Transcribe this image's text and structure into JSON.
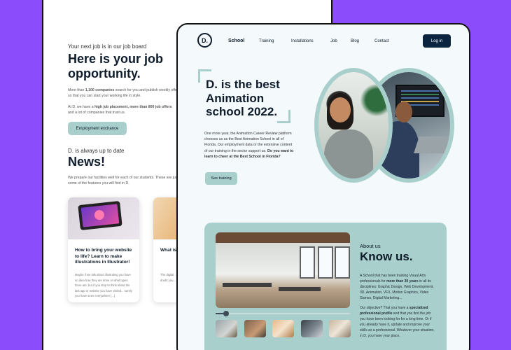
{
  "back": {
    "kicker": "Your next job is in our job board",
    "title": "Here is your job opportunity.",
    "para1_pre": "More than ",
    "para1_bold": "1,100 companies",
    "para1_post": " search for you and publish weekly offers so that you can start your working life in style.",
    "para2_pre": "At D. we have a ",
    "para2_bold": "high job placement, more than 800 job offers",
    "para2_post": " and a lot of companies that trust us.",
    "button": "Employment exchance",
    "news_kicker": "D. is always up to date",
    "news_title": "News!",
    "news_para": "We prepare our facilities well for each of our students. These are just some of the features you will find in D.",
    "cards": [
      {
        "title": "How to bring your website to life? Learn to make illustrations in Illustrator!",
        "text": "Maybe if we talk about illustrating you have no idea how they are done or what types there are, but if you stop to think about the last app or website you have visited... surely you have seen everywhere [...]"
      },
      {
        "title": "What is product doubts",
        "text": "The digital ... There are m... processes... doubt you..."
      }
    ]
  },
  "front": {
    "logo": "D.",
    "nav": [
      "School",
      "Training",
      "Installations",
      "Job",
      "Blog",
      "Contact"
    ],
    "login": "Log in",
    "hero_title": "D. is the best Animation school 2022.",
    "hero_para": "One more year, the Animation Career Review platform chooses us as the Best Animation School in all of Florida. Our employment data or the extensive content of our training in the sector support us. ",
    "hero_para_bold": "Do you want to learn to cheer at the Best School in Florida?",
    "hero_button": "See training",
    "about_kicker": "About us",
    "about_title": "Know us.",
    "about_p1_pre": "A School that has been training Visual Arts professionals for ",
    "about_p1_bold": "more than 30 years",
    "about_p1_post": " in all its disciplines: Graphic Design, Web Development, 3D, Animation, VFX, Motion Graphics, Video Games, Digital Marketing...",
    "about_p2_pre": "Our objective? That you have a ",
    "about_p2_bold": "specialized professional profile",
    "about_p2_post": " and that you find the job you have been looking for for a long time. Or if you already have it, update and improve your skills as a professional. Whatever your situation, in D. you have your place."
  },
  "colors": {
    "background": "#8b4dfb",
    "accent": "#a9cfcc",
    "navy": "#0d1b2a",
    "button_dark": "#0d2440"
  },
  "slider": {
    "progress": 0.08
  }
}
